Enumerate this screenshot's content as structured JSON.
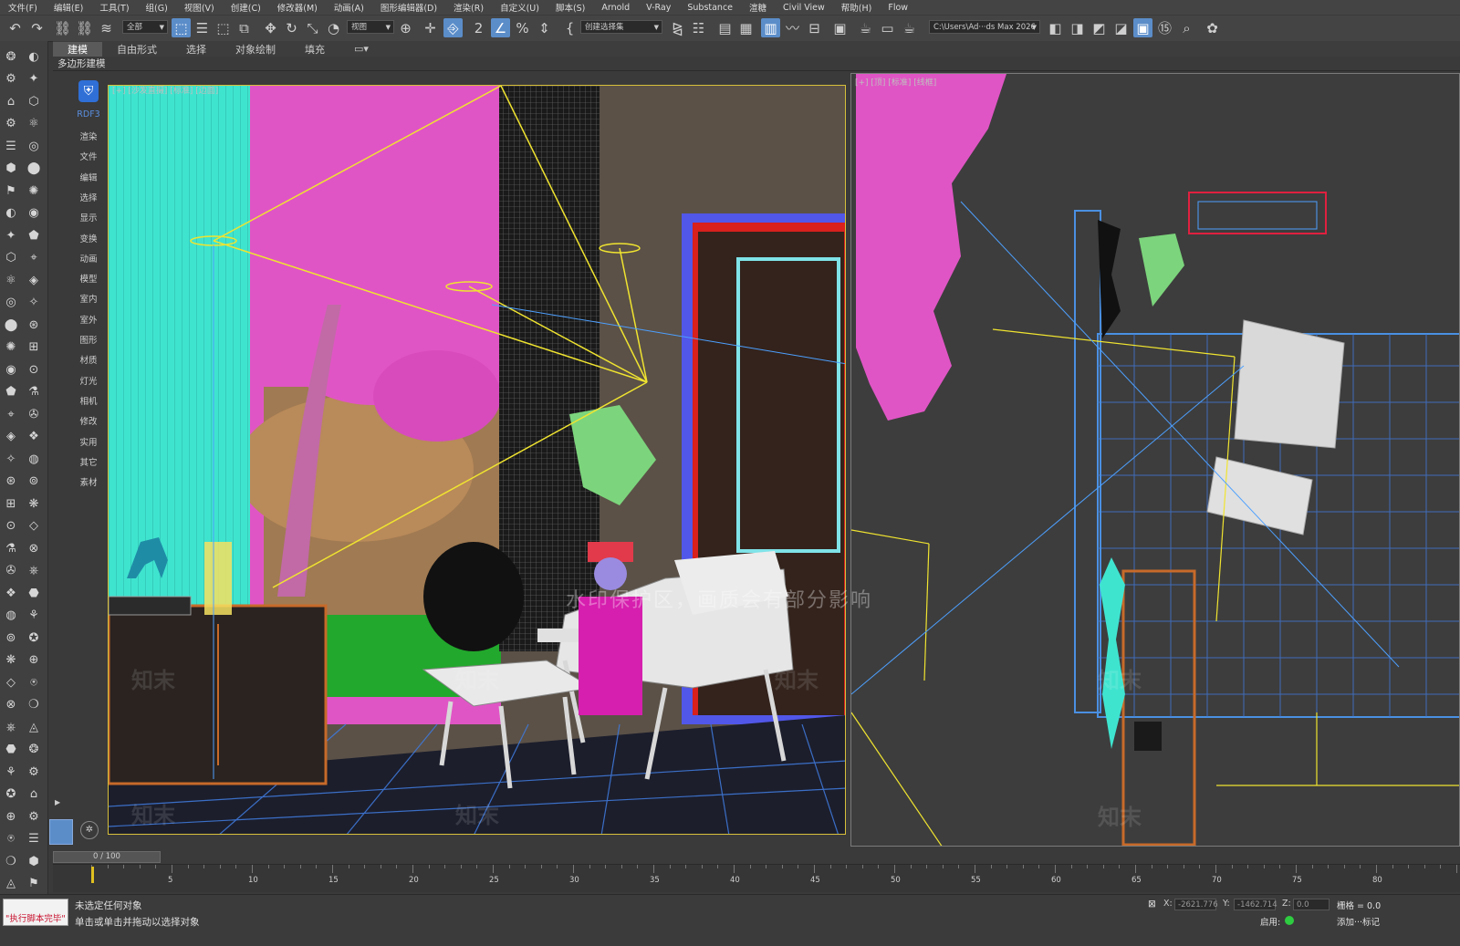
{
  "menu": [
    "文件(F)",
    "编辑(E)",
    "工具(T)",
    "组(G)",
    "视图(V)",
    "创建(C)",
    "修改器(M)",
    "动画(A)",
    "图形编辑器(D)",
    "渲染(R)",
    "自定义(U)",
    "脚本(S)",
    "Arnold",
    "V-Ray",
    "Substance",
    "渲糖",
    "Civil View",
    "帮助(H)",
    "Flow"
  ],
  "toolbar": {
    "selection_filter": "全部",
    "reference_coord": "视图",
    "named_selection": "创建选择集",
    "project_path": "C:\\Users\\Ad···ds Max 2026"
  },
  "ribbon": {
    "tabs": [
      "建模",
      "自由形式",
      "选择",
      "对象绘制",
      "填充"
    ],
    "selected": "建模",
    "subtab": "多边形建模"
  },
  "categories": {
    "logo_label": "RDF3",
    "items": [
      "渲染",
      "文件",
      "编辑",
      "选择",
      "显示",
      "变换",
      "动画",
      "模型",
      "室内",
      "室外",
      "图形",
      "材质",
      "灯光",
      "相机",
      "修改",
      "实用",
      "其它",
      "素材"
    ]
  },
  "viewport_left": {
    "label": "[+] [沙发直摄] [标准] [边面]"
  },
  "viewport_right": {
    "label": "[+] [顶] [标准] [线框]"
  },
  "watermark": "水印保护区，画质会有部分影响",
  "zhimo": "知末",
  "timeline": {
    "frame_display": "0 / 100",
    "ticks": [
      5,
      10,
      15,
      20,
      25,
      30,
      35,
      40,
      45,
      50,
      55,
      60,
      65,
      70,
      75,
      80
    ]
  },
  "status": {
    "script_label": "\"执行脚本完毕\"",
    "line1": "未选定任何对象",
    "line2": "单击或单击并拖动以选择对象",
    "x_label": "X:",
    "x_value": "-2621.776",
    "y_label": "Y:",
    "y_value": "-1462.714",
    "z_label": "Z:",
    "z_value": "0.0",
    "grid": "栅格 = 0.0",
    "enable": "启用:",
    "add_marker": "添加···标记"
  }
}
